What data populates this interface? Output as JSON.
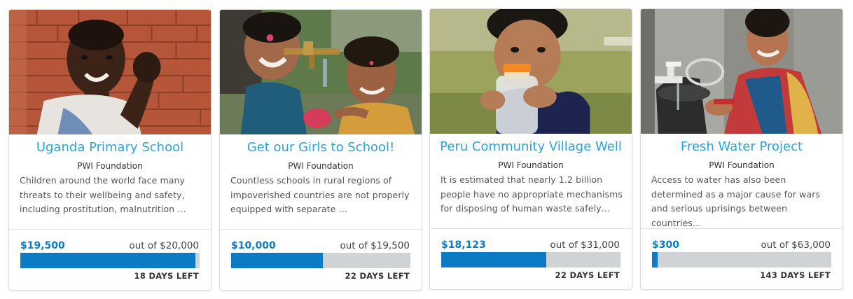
{
  "projects": [
    {
      "title": "Uganda Primary School",
      "organization": "PWI Foundation",
      "description": "Children around the world face many threats to their wellbeing and safety, including prostitution, malnutrition …",
      "raised": "$19,500",
      "goal": "out of $20,000",
      "progress": 0.975,
      "days_left": "18 DAYS LEFT",
      "image": "boy-smiling-brick-wall"
    },
    {
      "title": "Get our Girls to School!",
      "organization": "PWI Foundation",
      "description": "Countless schools in rural regions of impoverished countries are not properly equipped with separate …",
      "raised": "$10,000",
      "goal": "out of $19,500",
      "progress": 0.513,
      "days_left": "22 DAYS LEFT",
      "image": "girls-at-water-tap"
    },
    {
      "title": "Peru Community Village Well",
      "organization": "PWI Foundation",
      "description": "It is estimated that nearly 1.2 billion people have no appropriate mechanisms for disposing of human waste safely…",
      "raised": "$18,123",
      "goal": "out of $31,000",
      "progress": 0.585,
      "days_left": "22 DAYS LEFT",
      "image": "child-with-water-bottle"
    },
    {
      "title": "Fresh Water Project",
      "organization": "PWI Foundation",
      "description": "Access to water has also been determined as a major cause for wars and serious uprisings between countries…",
      "raised": "$300",
      "goal": "out of $63,000",
      "progress": 0.005,
      "days_left": "143 DAYS LEFT",
      "image": "woman-at-water-tap"
    }
  ],
  "colors": {
    "title": "#29a3d8",
    "raised": "#0b7bc5",
    "bar_fill": "#0b7bc5",
    "bar_track": "#cfd3d6"
  }
}
